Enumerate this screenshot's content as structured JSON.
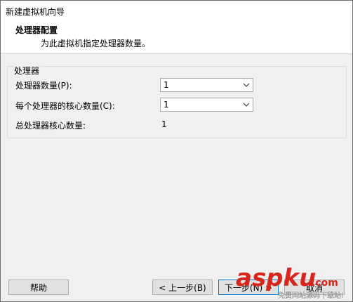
{
  "window": {
    "title": "新建虚拟机向导"
  },
  "header": {
    "heading": "处理器配置",
    "description": "为此虚拟机指定处理器数量。"
  },
  "processors": {
    "group_title": "处理器",
    "count_label": "处理器数量(P):",
    "count_value": "1",
    "cores_label": "每个处理器的核心数量(C):",
    "cores_value": "1",
    "total_label": "总处理器核心数量:",
    "total_value": "1"
  },
  "buttons": {
    "help": "帮助",
    "back": "< 上一步(B)",
    "next": "下一步(N) >",
    "cancel": "取消"
  },
  "watermark": {
    "brand": "aspku",
    "domain": ".com",
    "tagline": "免费网站源码下载站!"
  },
  "colors": {
    "watermark_red": "#d9261c",
    "focus_border": "#0078d7"
  }
}
